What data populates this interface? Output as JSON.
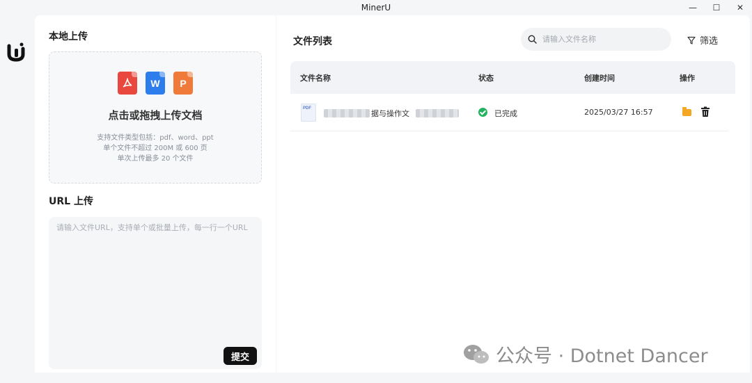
{
  "window": {
    "title": "MinerU",
    "controls": [
      "minimize",
      "maximize",
      "close"
    ]
  },
  "upload": {
    "local_title": "本地上传",
    "dropzone_title": "点击或拖拽上传文档",
    "file_type_icons": [
      {
        "name": "pdf-file-icon",
        "color": "#e8483d"
      },
      {
        "name": "word-file-icon",
        "glyph": "W",
        "color": "#2e7ded"
      },
      {
        "name": "ppt-file-icon",
        "glyph": "P",
        "color": "#f07a3a"
      }
    ],
    "hints": [
      "支持文件类型包括：pdf、word、ppt",
      "单个文件不超过 200M 或 600 页",
      "单次上传最多 20 个文件"
    ],
    "url_title": "URL 上传",
    "url_placeholder": "请输入文件URL，支持单个或批量上传，每一行一个URL",
    "submit_label": "提交"
  },
  "file_list": {
    "title": "文件列表",
    "search_placeholder": "请输入文件名称",
    "filter_label": "筛选",
    "columns": [
      "文件名称",
      "状态",
      "创建时间",
      "操作"
    ],
    "rows": [
      {
        "thumb_label": "PDF",
        "name_visible": "据与操作文",
        "status": "已完成",
        "created": "2025/03/27 16:57"
      }
    ]
  },
  "watermark": {
    "text": "公众号 · Dotnet Dancer"
  },
  "colors": {
    "accent": "#111111",
    "success": "#22b35e",
    "folder": "#f5a623"
  }
}
